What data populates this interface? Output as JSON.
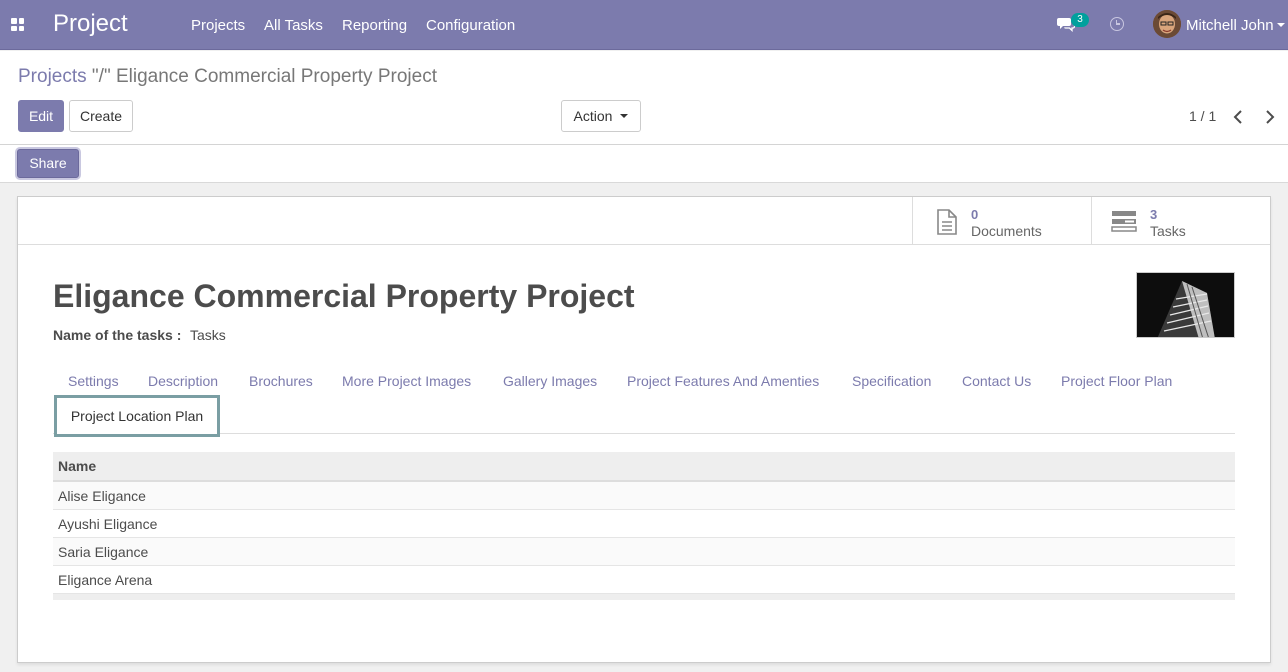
{
  "navbar": {
    "brand": "Project",
    "menu": [
      "Projects",
      "All Tasks",
      "Reporting",
      "Configuration"
    ],
    "message_count": "3",
    "user_name": "Mitchell John"
  },
  "breadcrumb": {
    "parent": "Projects",
    "separator": " \"/\" ",
    "current": "Eligance Commercial Property Project"
  },
  "toolbar": {
    "edit_label": "Edit",
    "create_label": "Create",
    "action_label": "Action",
    "pager": "1 / 1"
  },
  "share_label": "Share",
  "stats": [
    {
      "value": "0",
      "label": "Documents"
    },
    {
      "value": "3",
      "label": "Tasks"
    }
  ],
  "form": {
    "title": "Eligance Commercial Property Project",
    "tasks_label": "Name of the tasks :",
    "tasks_value": "Tasks"
  },
  "tabs": [
    "Settings",
    "Description",
    "Brochures",
    "More Project Images",
    "Gallery Images",
    "Project Features And Amenties",
    "Specification",
    "Contact Us",
    "Project Floor Plan",
    "Project Location Plan"
  ],
  "table": {
    "header": "Name",
    "rows": [
      "Alise Eligance",
      "Ayushi Eligance",
      "Saria Eligance",
      "Eligance Arena"
    ]
  },
  "colors": {
    "brand": "#7c7bad",
    "badge": "#00a09d",
    "active_tab_border": "#7a9ea3"
  }
}
